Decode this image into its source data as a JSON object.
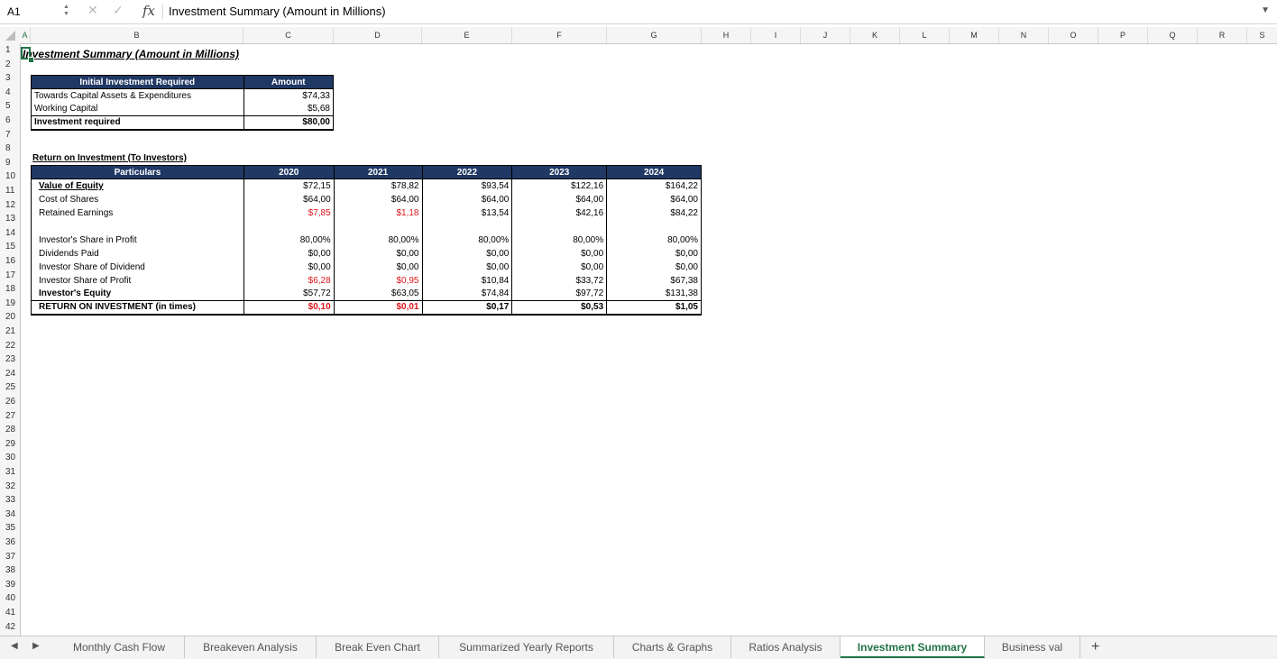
{
  "formula_bar": {
    "name_box": "A1",
    "cancel_glyph": "✕",
    "enter_glyph": "✓",
    "fx_label": "fx",
    "content": "Investment Summary (Amount in Millions)"
  },
  "columns": [
    "A",
    "B",
    "C",
    "D",
    "E",
    "F",
    "G",
    "H",
    "I",
    "J",
    "K",
    "L",
    "M",
    "N",
    "O",
    "P",
    "Q",
    "R",
    "S"
  ],
  "rows": [
    "1",
    "2",
    "3",
    "4",
    "5",
    "6",
    "7",
    "8",
    "9",
    "10",
    "11",
    "12",
    "13",
    "14",
    "15",
    "16",
    "17",
    "18",
    "19",
    "20",
    "21",
    "22",
    "23",
    "24",
    "25",
    "26",
    "27",
    "28",
    "29",
    "30",
    "31",
    "32",
    "33",
    "34",
    "35",
    "36",
    "37",
    "38",
    "39",
    "40",
    "41",
    "42"
  ],
  "sheet": {
    "title": "Investment Summary (Amount in Millions)",
    "initial_investment": {
      "header_label": "Initial Investment Required",
      "header_amount": "Amount",
      "rows": [
        {
          "label": "Towards Capital Assets & Expenditures",
          "amount": "$74,33"
        },
        {
          "label": "Working Capital",
          "amount": "$5,68"
        }
      ],
      "total": {
        "label": "Investment required",
        "amount": "$80,00"
      }
    },
    "return_table": {
      "title": "Return on Investment (To Investors)",
      "header_label": "Particulars",
      "years": [
        "2020",
        "2021",
        "2022",
        "2023",
        "2024"
      ],
      "rows": [
        {
          "label": "Value of Equity",
          "values": [
            "$72,15",
            "$78,82",
            "$93,54",
            "$122,16",
            "$164,22"
          ]
        },
        {
          "label": "Cost of Shares",
          "values": [
            "$64,00",
            "$64,00",
            "$64,00",
            "$64,00",
            "$64,00"
          ]
        },
        {
          "label": "Retained Earnings",
          "values": [
            "$7,85",
            "$1,18",
            "$13,54",
            "$42,16",
            "$84,22"
          ]
        },
        {
          "label": "Investor's Share in Profit",
          "values": [
            "80,00%",
            "80,00%",
            "80,00%",
            "80,00%",
            "80,00%"
          ]
        },
        {
          "label": "Dividends Paid",
          "values": [
            "$0,00",
            "$0,00",
            "$0,00",
            "$0,00",
            "$0,00"
          ]
        },
        {
          "label": "Investor Share of Dividend",
          "values": [
            "$0,00",
            "$0,00",
            "$0,00",
            "$0,00",
            "$0,00"
          ]
        },
        {
          "label": "Investor Share of Profit",
          "values": [
            "$6,28",
            "$0,95",
            "$10,84",
            "$33,72",
            "$67,38"
          ]
        },
        {
          "label": "Investor's Equity",
          "values": [
            "$57,72",
            "$63,05",
            "$74,84",
            "$97,72",
            "$131,38"
          ]
        },
        {
          "label": "RETURN ON INVESTMENT (in times)",
          "values": [
            "$0,10",
            "$0,01",
            "$0,17",
            "$0,53",
            "$1,05"
          ]
        }
      ]
    }
  },
  "tabs": {
    "prev_glyph": "◀",
    "next_glyph": "▶",
    "items": [
      "Monthly Cash Flow",
      "Breakeven Analysis",
      "Break Even Chart",
      "Summarized Yearly Reports",
      "Charts & Graphs",
      "Ratios Analysis",
      "Investment Summary",
      "Business val"
    ],
    "active": "Investment Summary",
    "add_glyph": "+"
  },
  "colors": {
    "header_fill": "#1f3864",
    "negative_red": "#e0161a",
    "excel_green": "#217346"
  }
}
